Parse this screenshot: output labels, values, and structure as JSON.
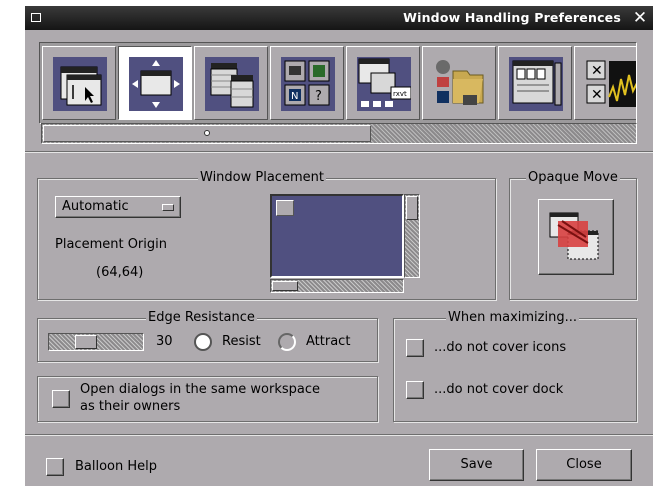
{
  "window": {
    "title": "Window Handling Preferences"
  },
  "sections": [
    {
      "icon": "window-focus-icon"
    },
    {
      "icon": "window-handling-icon",
      "selected": true
    },
    {
      "icon": "menu-preferences-icon"
    },
    {
      "icon": "icon-preferences-icon"
    },
    {
      "icon": "workspace-icon",
      "text": "rxvt"
    },
    {
      "icon": "paths-icon"
    },
    {
      "icon": "appearance-icon"
    },
    {
      "icon": "ergonomics-icon"
    }
  ],
  "placement": {
    "legend": "Window Placement",
    "mode": "Automatic",
    "origin_label": "Placement Origin",
    "origin_value": "(64,64)"
  },
  "opaque": {
    "legend": "Opaque Move"
  },
  "edge": {
    "legend": "Edge Resistance",
    "value": "30",
    "resist_label": "Resist",
    "attract_label": "Attract",
    "selected": "Resist"
  },
  "maximize": {
    "legend": "When maximizing...",
    "icons_label": "...do not cover icons",
    "dock_label": "...do not cover dock"
  },
  "dialogs": {
    "line1": "Open dialogs in the same workspace",
    "line2": "as their owners"
  },
  "footer": {
    "balloon_label": "Balloon Help",
    "save_label": "Save",
    "close_label": "Close"
  },
  "colors": {
    "panel": "#aeaaae",
    "preview": "#505080",
    "titlebar": "#151515"
  }
}
